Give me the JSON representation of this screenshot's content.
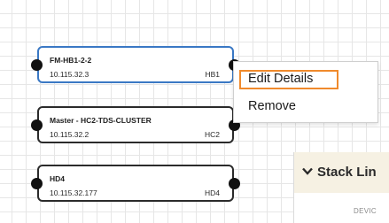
{
  "nodes": [
    {
      "name": "FM-HB1-2-2",
      "ip": "10.115.32.3",
      "tag": "HB1",
      "selected": true
    },
    {
      "name": "Master - HC2-TDS-CLUSTER",
      "ip": "10.115.32.2",
      "tag": "HC2",
      "selected": false
    },
    {
      "name": "HD4",
      "ip": "10.115.32.177",
      "tag": "HD4",
      "selected": false
    }
  ],
  "context_menu": {
    "items": [
      "Edit Details",
      "Remove"
    ],
    "highlighted_item": "Edit Details",
    "highlight_color": "#f08a2c"
  },
  "stack_panel": {
    "title": "Stack Lin",
    "chevron_icon": "chevron-down-icon",
    "column_label": "DEVIC"
  },
  "colors": {
    "selected_border": "#3a78c4",
    "node_border": "#2b2b2b",
    "panel_header_bg": "#f6f1e3"
  }
}
